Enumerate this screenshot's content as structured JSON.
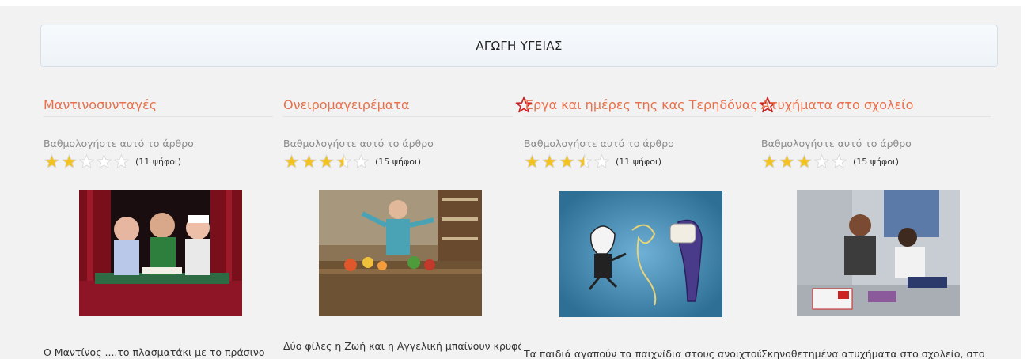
{
  "header": {
    "title": "ΑΓΩΓΗ ΥΓΕΙΑΣ"
  },
  "rating_label": "Βαθμολογήστε αυτό το άρθρο",
  "colors": {
    "accent": "#e8704a",
    "star_fill": "#f4c21f",
    "fav_star": "#cc2222"
  },
  "articles": [
    {
      "title": "Μαντινοσυνταγές",
      "rating": 2,
      "votes_label": "(11 ψήφοι)",
      "description": "Ο Μαντίνος ....το πλασματάκι με το πράσινο"
    },
    {
      "title": "Ονειρομαγειρέματα",
      "rating": 3.5,
      "votes_label": "(15 ψήφοι)",
      "description": "Δύο φίλες η Ζωή και η Αγγελική μπαίνουν κρυφά"
    },
    {
      "title": "Έργα και ημέρες της κας Τερηδόνας",
      "rating": 3.5,
      "votes_label": "(11 ψήφοι)",
      "description": "Τα παιδιά αγαπούν τα παιχνίδια στους ανοιχτούς"
    },
    {
      "title": "Ατυχήματα στο σχολείο",
      "rating": 3,
      "votes_label": "(15 ψήφοι)",
      "description": "Σκηνοθετημένα ατυχήματα στο σχολείο, στο"
    }
  ]
}
